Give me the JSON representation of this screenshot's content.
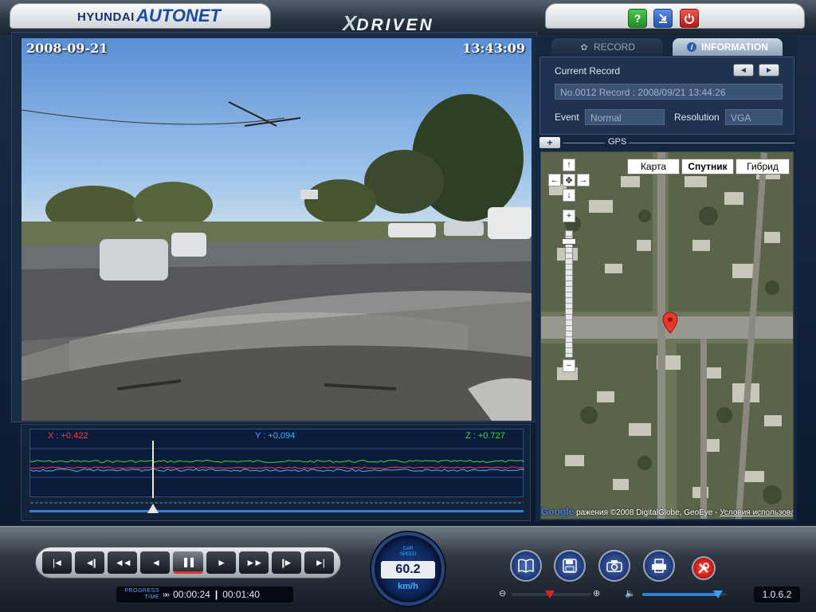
{
  "header": {
    "brand_hyundai": "HYUNDAI",
    "brand_autonet": "AUTONET",
    "center_logo_x": "X",
    "center_logo_text": "DRIVEN",
    "help_label": "?",
    "minimize_icon": "minimize-icon",
    "power_icon": "power-icon"
  },
  "video": {
    "date": "2008-09-21",
    "time": "13:43:09"
  },
  "gsensor": {
    "x_label": "X  : +0.422",
    "y_label": "Y  : +0.094",
    "z_label": "Z  : +0.727",
    "x_color": "#ff3a3a",
    "y_color": "#38b8ff",
    "z_color": "#36e036",
    "playhead_fraction": 0.25
  },
  "tabs": {
    "record": "RECORD",
    "information": "INFORMATION",
    "info_icon": "i"
  },
  "info": {
    "current_record_label": "Current Record",
    "prev_btn": "◄",
    "next_btn": "►",
    "record_value": "No.0012 Record : 2008/09/21 13:44:26",
    "event_label": "Event",
    "event_value": "Normal",
    "resolution_label": "Resolution",
    "resolution_value": "VGA"
  },
  "gps": {
    "expand_btn": "+",
    "label": "GPS",
    "map_types": [
      "Карта",
      "Спутник",
      "Гибрид"
    ],
    "selected_map_type": "Спутник",
    "zoom_in": "+",
    "zoom_out": "−",
    "pan_up": "↑",
    "pan_down": "↓",
    "pan_left": "←",
    "pan_right": "→",
    "pan_center": "✥",
    "footer_google": "Google",
    "footer_text": "ражения ©2008 DigitalGlobe, GeoEye - ",
    "footer_link": "Условия использования"
  },
  "transport": {
    "buttons": [
      "|◄",
      "◄||",
      "◄◄",
      "◄",
      "❚❚",
      "►",
      "►►",
      "||►",
      "►|"
    ],
    "active_index": 4
  },
  "time": {
    "label_line1": "PROGRESS",
    "label_line2": "TIME",
    "arrows": "»»",
    "current": "00:00:24",
    "total": "00:01:40"
  },
  "speed": {
    "title_line1": "CAR",
    "title_line2": "SPEED",
    "value": "60.2",
    "unit": "km/h"
  },
  "controls": {
    "icons": [
      "book-icon",
      "save-icon",
      "camera-icon",
      "print-icon",
      "tools-icon"
    ]
  },
  "zoom_slider": {
    "minus": "⊖",
    "plus": "⊕",
    "level": 0.48
  },
  "volume_slider": {
    "icon": "🔈",
    "level": 0.9
  },
  "version": "1.0.6.2"
}
